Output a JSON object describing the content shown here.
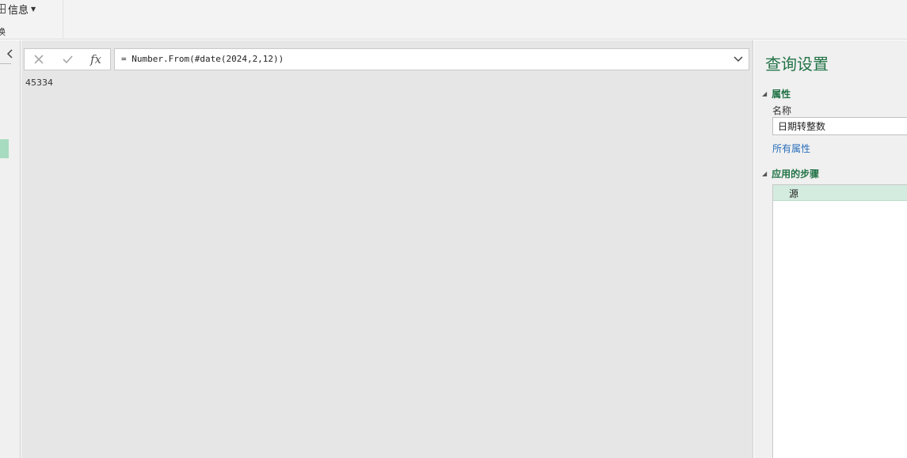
{
  "ribbon": {
    "info_label": "信息",
    "sub_label": "换"
  },
  "queries_pane": {
    "collapse_glyph": "‹"
  },
  "formula": {
    "cancel_glyph": "✕",
    "commit_glyph": "✓",
    "fx_label": "fx",
    "text": "= Number.From(#date(2024,2,12))"
  },
  "result": {
    "value": "45334"
  },
  "settings": {
    "title": "查询设置",
    "properties_header": "属性",
    "name_label": "名称",
    "name_value": "日期转整数",
    "all_properties_link": "所有属性",
    "applied_steps_header": "应用的步骤",
    "steps": [
      {
        "label": "源"
      }
    ]
  },
  "colors": {
    "accent": "#217346",
    "link": "#2a6ebb",
    "selected_step": "#d4ecdf",
    "editor_bg": "#e6e6e6"
  },
  "icons": {
    "ribbon": "grid-icon",
    "expand": "chevron-down-icon",
    "section": "triangle-collapse-icon"
  }
}
